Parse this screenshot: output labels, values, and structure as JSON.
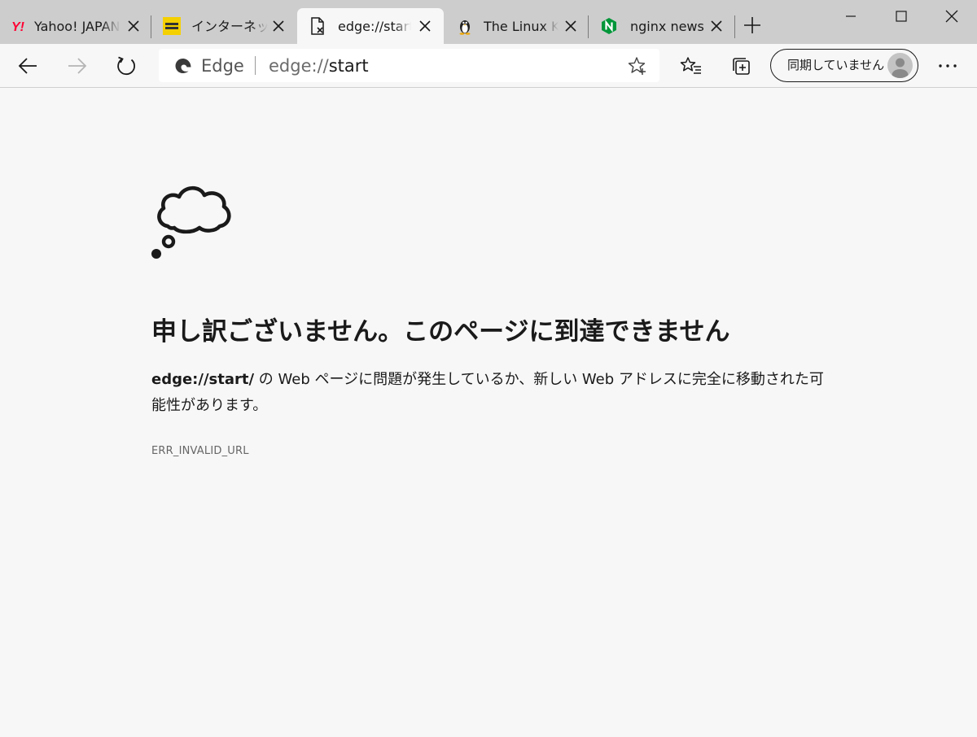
{
  "tabs": [
    {
      "title": "Yahoo! JAPAN",
      "favicon": "yahoo-icon",
      "active": false
    },
    {
      "title": "インターネット Watch",
      "favicon": "internet-watch-icon",
      "active": false
    },
    {
      "title": "edge://start/",
      "favicon": "error-page-icon",
      "active": true
    },
    {
      "title": "The Linux Kernel Archives",
      "favicon": "linux-penguin-icon",
      "active": false
    },
    {
      "title": "nginx news",
      "favicon": "nginx-icon",
      "active": false
    }
  ],
  "omnibox": {
    "brand": "Edge",
    "url_scheme": "edge://",
    "url_host": "start"
  },
  "profile": {
    "sync_label": "同期していません"
  },
  "error": {
    "title": "申し訳ございません。このページに到達できません",
    "url_bold": "edge://start/",
    "description": " の Web ページに問題が発生しているか、新しい Web アドレスに完全に移動された可能性があります。",
    "code": "ERR_INVALID_URL"
  },
  "colors": {
    "tabstrip_bg": "#cdcdcd",
    "page_bg": "#f7f7f7",
    "yahoo_red": "#ff0033",
    "internet_watch_yellow": "#f5d000",
    "nginx_green": "#009639"
  }
}
